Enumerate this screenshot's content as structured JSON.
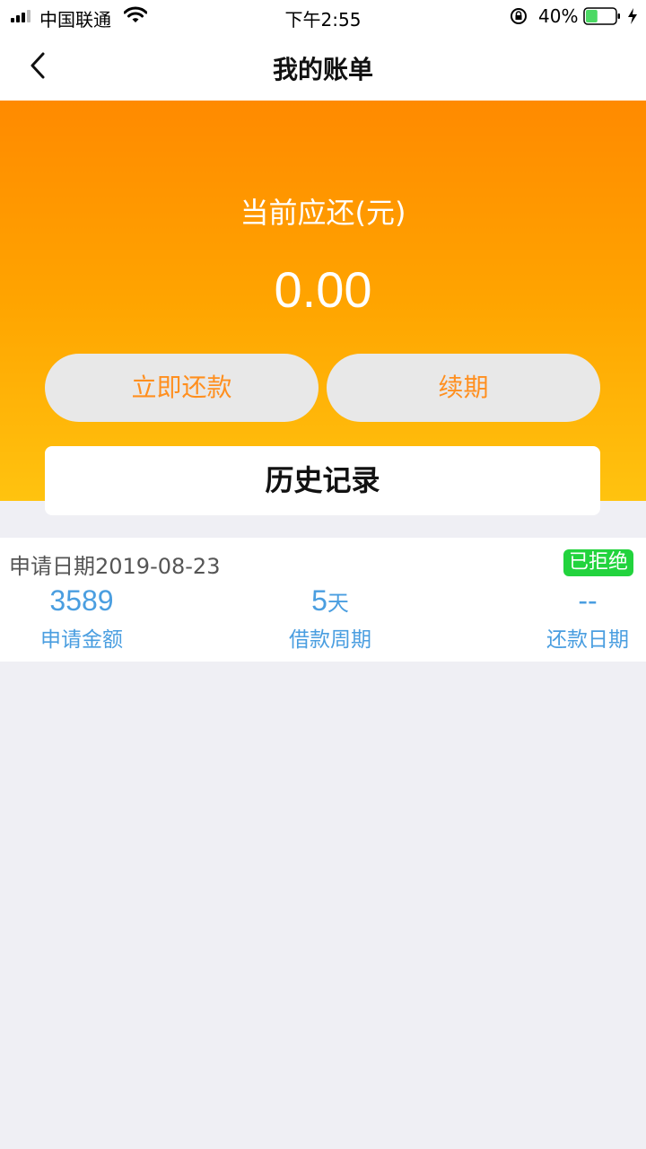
{
  "status_bar": {
    "carrier": "中国联通",
    "time": "下午2:55",
    "battery_percent": "40%",
    "battery_level": 0.4
  },
  "nav": {
    "title": "我的账单"
  },
  "bill": {
    "due_label": "当前应还(元)",
    "due_amount": "0.00",
    "repay_button": "立即还款",
    "renew_button": "续期",
    "history_button": "历史记录"
  },
  "records": [
    {
      "apply_date": "申请日期2019-08-23",
      "status": "已拒绝",
      "amount": "3589",
      "amount_label": "申请金额",
      "period_value": "5",
      "period_unit": "天",
      "period_label": "借款周期",
      "repay_date": "--",
      "repay_date_label": "还款日期"
    }
  ],
  "colors": {
    "accent_orange": "#ff8f1f",
    "link_blue": "#4a9ee0",
    "status_green": "#22d33d",
    "background": "#efeff4"
  }
}
